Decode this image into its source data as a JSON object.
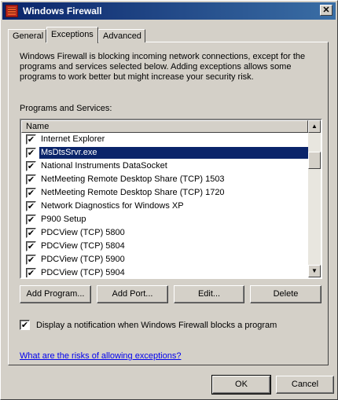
{
  "window": {
    "title": "Windows Firewall",
    "close_glyph": "✕"
  },
  "tabs": [
    {
      "label": "General",
      "active": false
    },
    {
      "label": "Exceptions",
      "active": true
    },
    {
      "label": "Advanced",
      "active": false
    }
  ],
  "exceptions": {
    "description": "Windows Firewall is blocking incoming network connections, except for the programs and services selected below. Adding exceptions allows some programs to work better but might increase your security risk.",
    "section_label": "Programs and Services:",
    "column_header": "Name",
    "items": [
      {
        "label": "Internet Explorer",
        "checked": true,
        "selected": false
      },
      {
        "label": "MsDtsSrvr.exe",
        "checked": true,
        "selected": true
      },
      {
        "label": "National Instruments DataSocket",
        "checked": true,
        "selected": false
      },
      {
        "label": "NetMeeting Remote Desktop Share (TCP) 1503",
        "checked": true,
        "selected": false
      },
      {
        "label": "NetMeeting Remote Desktop Share (TCP) 1720",
        "checked": true,
        "selected": false
      },
      {
        "label": "Network Diagnostics for Windows XP",
        "checked": true,
        "selected": false
      },
      {
        "label": "P900 Setup",
        "checked": true,
        "selected": false
      },
      {
        "label": "PDCView (TCP) 5800",
        "checked": true,
        "selected": false
      },
      {
        "label": "PDCView (TCP) 5804",
        "checked": true,
        "selected": false
      },
      {
        "label": "PDCView (TCP) 5900",
        "checked": true,
        "selected": false
      },
      {
        "label": "PDCView (TCP) 5904",
        "checked": true,
        "selected": false
      }
    ],
    "buttons": {
      "add_program": "Add Program...",
      "add_port": "Add Port...",
      "edit": "Edit...",
      "delete": "Delete"
    },
    "notification_label": "Display a notification when Windows Firewall blocks a program",
    "notification_checked": true,
    "risk_link": "What are the risks of allowing exceptions?"
  },
  "footer": {
    "ok": "OK",
    "cancel": "Cancel"
  },
  "icons": {
    "check": "✔",
    "scroll_up": "▲",
    "scroll_down": "▼"
  }
}
